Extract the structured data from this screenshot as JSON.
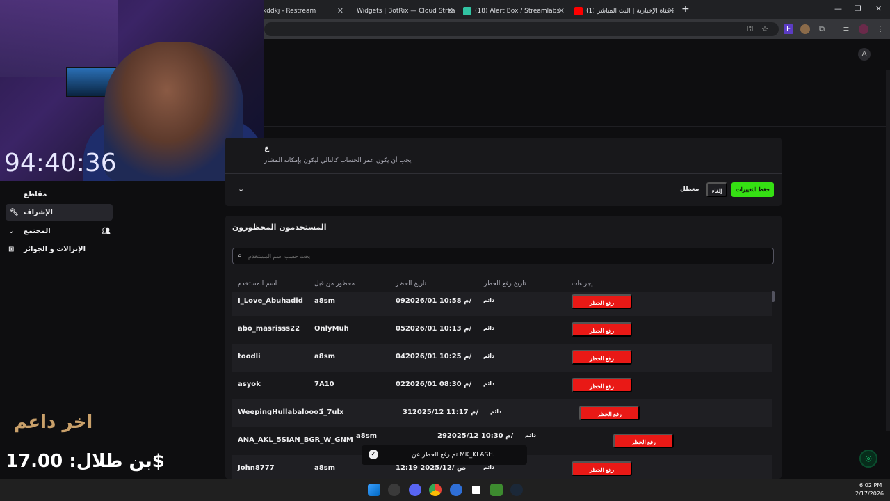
{
  "browser": {
    "tabs": [
      {
        "title": "kddkj - Restream",
        "active": false
      },
      {
        "title": "Widgets | BotRix — Cloud Strea",
        "active": false
      },
      {
        "title": "(18) Alert Box / Streamlabs",
        "active": false
      },
      {
        "title": "(1) قناة الإخبارية | البث المباشر -",
        "active": false
      }
    ],
    "new_tab": "+",
    "window_controls": [
      "—",
      "❐",
      "✕"
    ]
  },
  "webcam": {
    "timer": "94:40:36"
  },
  "sidebar": {
    "items": [
      {
        "label": "مقاطع",
        "icon": "clips-icon",
        "active": false
      },
      {
        "label": "الإشراف",
        "icon": "wrench-icon",
        "active": true
      },
      {
        "label": "المجتمع",
        "icon": "community-icon",
        "active": false
      },
      {
        "label": "الإنزالات و الجوائز",
        "icon": "gift-icon",
        "active": false
      }
    ]
  },
  "donation": {
    "label": "اخر داعم",
    "value": "بن طلال: 17.00$"
  },
  "settings": {
    "heading": "ع",
    "description": "يجب أن يكون عمر الحساب كالتالي ليكون بإمكانه المشار",
    "status": "معطل",
    "cancel_label": "إلغاء",
    "save_label": "حفظ التغييرات"
  },
  "banned": {
    "title": "المستخدمون المحظورون",
    "search_placeholder": "ابحث حسب اسم المستخدم",
    "columns": [
      "اسم المستخدم",
      "محظور من قبل",
      "تاريخ الحظر",
      "تاريخ رفع الحظر",
      "إجراءات"
    ],
    "unban_label": "رفع الحظر",
    "rows": [
      {
        "username": "I_Love_Abuhadid",
        "banned_by": "a8sm",
        "date": "09م 10:58 2026/01/",
        "expiry": "دائم"
      },
      {
        "username": "abo_masrisss22",
        "banned_by": "OnlyMuh",
        "date": "05م 10:13 2026/01/",
        "expiry": "دائم"
      },
      {
        "username": "toodli",
        "banned_by": "a8sm",
        "date": "04م 10:25 2026/01/",
        "expiry": "دائم"
      },
      {
        "username": "asyok",
        "banned_by": "7A10",
        "date": "02م 08:30 2026/01/",
        "expiry": "دائم"
      },
      {
        "username": "WeepingHullabalooo1",
        "banned_by": "i_7ulx",
        "date": "31م 11:17 2025/12/",
        "expiry": "دائم"
      },
      {
        "username": "ANA_AKL_5SIAN_BGR_W_GNM",
        "banned_by": "a8sm",
        "date": "29م 10:30 2025/12/",
        "expiry": "دائم"
      },
      {
        "username": "John8777",
        "banned_by": "a8sm",
        "date": "12:19 2025/12/ ص",
        "expiry": "دائم"
      }
    ]
  },
  "toast": {
    "text": "تم رفع الحظر عن MK_KLASH."
  },
  "taskbar": {
    "time": "6:02 PM",
    "date": "2/17/2026"
  }
}
